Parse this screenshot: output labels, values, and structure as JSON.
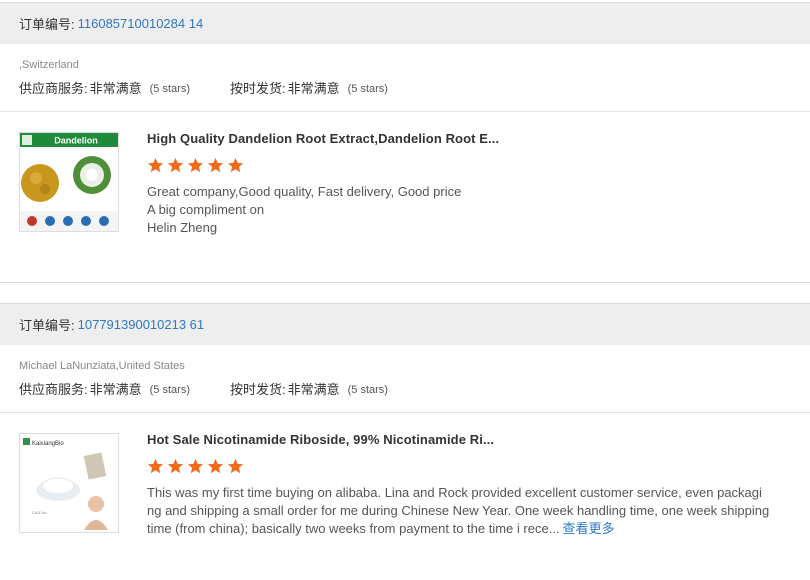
{
  "colors": {
    "link": "#2f78c4",
    "star": "#f26b1d",
    "header_bg": "#eeeeee"
  },
  "orders": [
    {
      "order_label": "订单编号:",
      "order_number": "116085710010284 14",
      "buyer": ",Switzerland",
      "supplier_service_label": "供应商服务:",
      "supplier_service_value": "非常满意",
      "supplier_service_stars": "(5 stars)",
      "ontime_label": "按时发货:",
      "ontime_value": "非常满意",
      "ontime_stars": "(5 stars)",
      "product_title": "High Quality Dandelion Root Extract,Dandelion Root E...",
      "thumb_label": "Dandelion",
      "rating": 5,
      "comment_lines": [
        "Great company,Good quality, Fast delivery, Good price",
        "A big compliment on",
        "Helin Zheng"
      ]
    },
    {
      "order_label": "订单编号:",
      "order_number": "107791390010213 61",
      "buyer": "Michael LaNunziata,United States",
      "supplier_service_label": "供应商服务:",
      "supplier_service_value": "非常满意",
      "supplier_service_stars": "(5 stars)",
      "ontime_label": "按时发货:",
      "ontime_value": "非常满意",
      "ontime_stars": "(5 stars)",
      "product_title": "Hot Sale Nicotinamide Riboside, 99% Nicotinamide Ri...",
      "thumb_label": "KaixiangBio",
      "rating": 5,
      "comment_lines": [
        "This was my first time buying on alibaba.  Lina and Rock provided excellent customer service, even packagi",
        "ng and shipping a small order for me during Chinese New Year. One week handling time, one week shipping",
        "time (from china); basically two weeks from payment to the time i rece..."
      ],
      "more_link": "查看更多"
    }
  ]
}
